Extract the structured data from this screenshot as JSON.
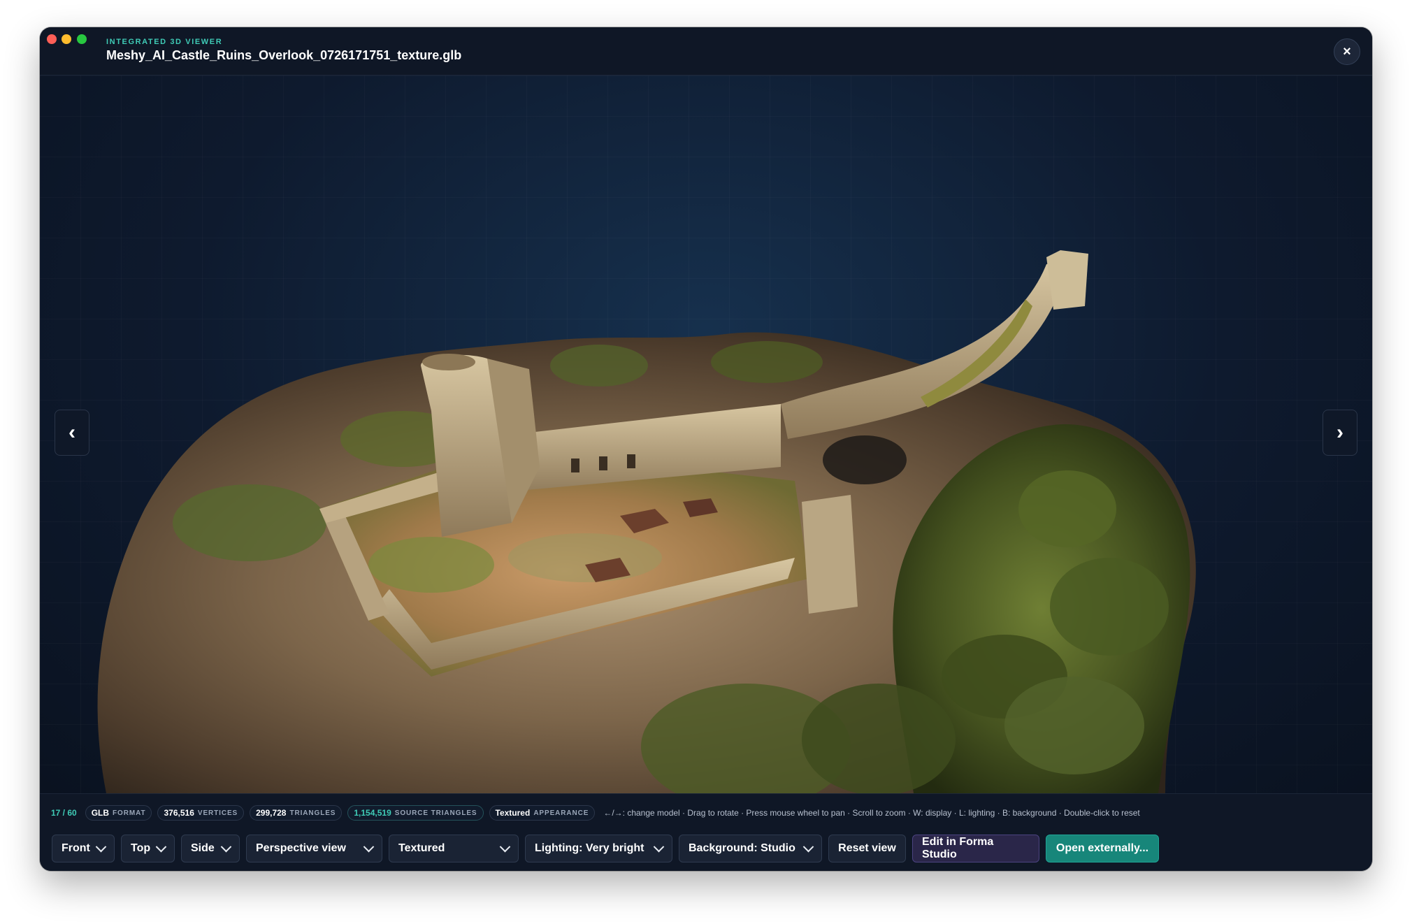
{
  "window": {
    "kicker": "INTEGRATED 3D VIEWER",
    "title": "Meshy_AI_Castle_Ruins_Overlook_0726171751_texture.glb",
    "close_icon": "×"
  },
  "viewer": {
    "prev_icon": "‹",
    "next_icon": "›"
  },
  "stats": {
    "counter": "17 / 60",
    "format_value": "GLB",
    "format_label": "FORMAT",
    "vertices_value": "376,516",
    "vertices_label": "VERTICES",
    "triangles_value": "299,728",
    "triangles_label": "TRIANGLES",
    "source_triangles_value": "1,154,519",
    "source_triangles_label": "SOURCE TRIANGLES",
    "appearance_value": "Textured",
    "appearance_label": "APPEARANCE",
    "hint": "←/→: change model · Drag to rotate · Press mouse wheel to pan · Scroll to zoom · W: display · L: lighting · B: background · Double-click to reset"
  },
  "controls": {
    "front": "Front",
    "top": "Top",
    "side": "Side",
    "projection": "Perspective view",
    "display": "Textured",
    "lighting": "Lighting: Very bright",
    "background": "Background: Studio",
    "reset": "Reset view",
    "edit": "Edit in Forma Studio",
    "open": "Open externally..."
  },
  "colors": {
    "accent": "#3fcbb6",
    "open_button": "#17867a",
    "forma_button": "#2a2649",
    "window_bg": "#0e1626"
  }
}
